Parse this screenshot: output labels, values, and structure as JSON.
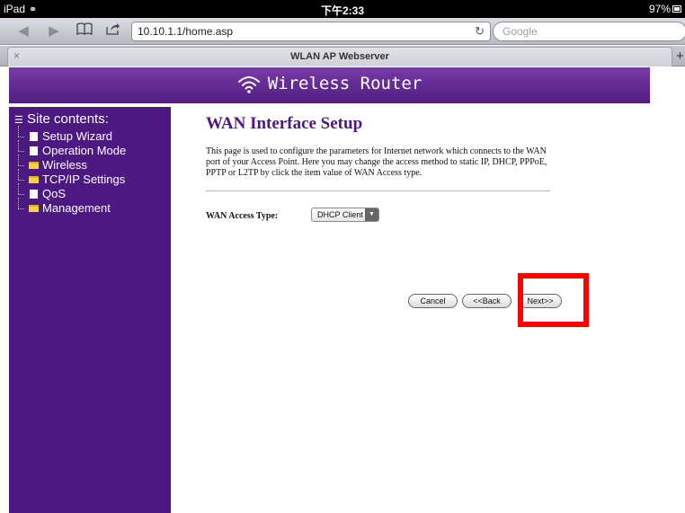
{
  "status_bar": {
    "device": "iPad",
    "time": "下午2:33",
    "battery": "97%"
  },
  "browser": {
    "url": "10.10.1.1/home.asp",
    "search_placeholder": "Google",
    "tab_title": "WLAN AP Webserver",
    "tab_close": "×",
    "new_tab": "+"
  },
  "banner": {
    "title": "Wireless Router"
  },
  "sidebar": {
    "title": "Site contents:",
    "items": [
      {
        "label": "Setup Wizard",
        "icon": "document-icon"
      },
      {
        "label": "Operation Mode",
        "icon": "document-icon"
      },
      {
        "label": "Wireless",
        "icon": "folder-icon"
      },
      {
        "label": "TCP/IP Settings",
        "icon": "folder-icon"
      },
      {
        "label": "QoS",
        "icon": "document-icon"
      },
      {
        "label": "Management",
        "icon": "folder-icon"
      }
    ]
  },
  "main": {
    "title": "WAN Interface Setup",
    "description": "This page is used to configure the parameters for Internet network which connects to the WAN port of your Access Point. Here you may change the access method to static IP, DHCP, PPPoE, PPTP or L2TP by click the item value of WAN Access type.",
    "wan_access_label": "WAN Access Type:",
    "wan_access_value": "DHCP Client",
    "buttons": {
      "cancel": "Cancel",
      "back": "<<Back",
      "next": "Next>>"
    }
  },
  "colors": {
    "brand_purple": "#4c1981",
    "highlight": "#ff0000"
  }
}
